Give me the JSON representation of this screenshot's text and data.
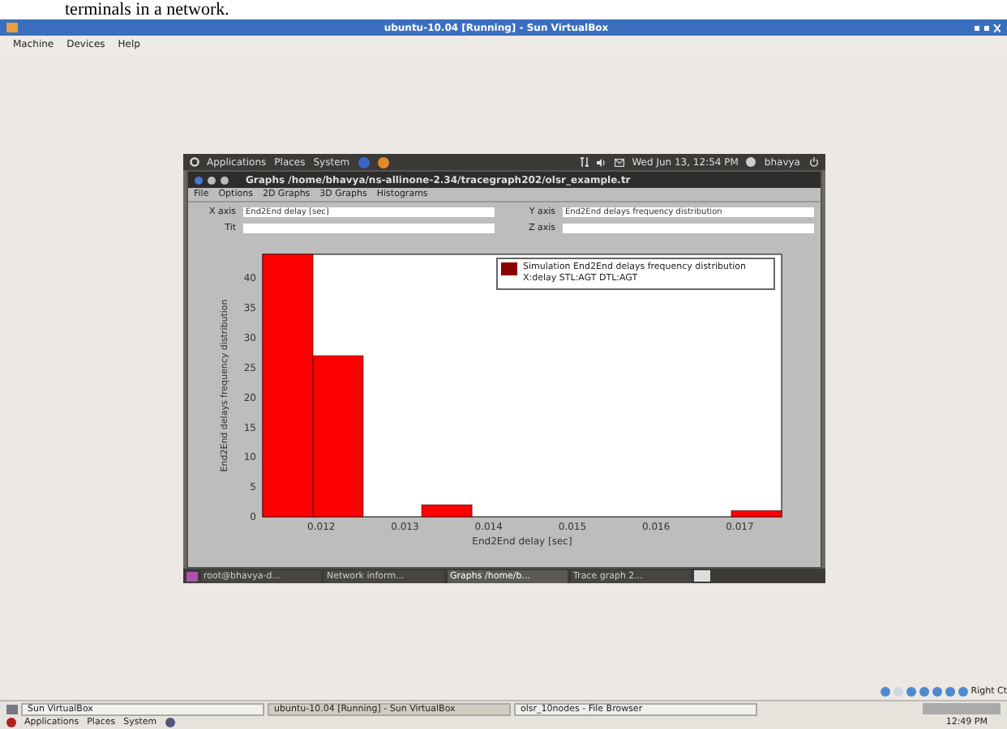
{
  "document_text": "terminals in a network.",
  "window": {
    "title": "ubuntu-10.04 [Running] - Sun VirtualBox",
    "menu": [
      "Machine",
      "Devices",
      "Help"
    ]
  },
  "guest": {
    "panel": {
      "menu": [
        "Applications",
        "Places",
        "System"
      ],
      "clock": "Wed Jun 13, 12:54 PM",
      "user": "bhavya"
    },
    "app": {
      "title": "Graphs  /home/bhavya/ns-allinone-2.34/tracegraph202/olsr_example.tr",
      "menu": [
        "File",
        "Options",
        "2D Graphs",
        "3D Graphs",
        "Histograms"
      ],
      "fields": [
        {
          "label": "X axis",
          "value": "End2End delay [sec]"
        },
        {
          "label": "Y axis",
          "value": "End2End delays frequency distribution"
        },
        {
          "label": "Tit"
        },
        {
          "label": "Z axis"
        }
      ],
      "chart_data": {
        "type": "bar",
        "xlabel": "End2End delay [sec]",
        "ylabel": "End2End delays frequency distribution",
        "x": [
          0.0116,
          0.0122,
          0.0135,
          0.0172
        ],
        "series": [
          {
            "name": "Simulation End2End delays frequency distribution X:delay STL:AGT DTL:AGT",
            "color": "#ff0000",
            "values": [
              44,
              27,
              2,
              1
            ]
          }
        ],
        "xlim": [
          0.0113,
          0.0175
        ],
        "ylim": [
          0,
          44
        ],
        "xticks": [
          0.012,
          0.013,
          0.014,
          0.015,
          0.016,
          0.017
        ],
        "yticks": [
          0,
          5,
          10,
          15,
          20,
          25,
          30,
          35,
          40
        ]
      }
    },
    "taskbar": [
      {
        "label": "root@bhavya-d...",
        "selected": false
      },
      {
        "label": "Network inform...",
        "selected": false
      },
      {
        "label": "Graphs  /home/b...",
        "selected": true
      },
      {
        "label": "Trace graph 2...",
        "selected": false
      }
    ]
  },
  "host_status": {
    "hint": "Right Ct"
  },
  "host_taskbar": [
    {
      "label": "Sun VirtualBox",
      "selected": false
    },
    {
      "label": "ubuntu-10.04 [Running] - Sun VirtualBox",
      "selected": true
    },
    {
      "label": "olsr_10nodes - File Browser",
      "selected": false
    }
  ],
  "host_panel": {
    "menu": [
      "Applications",
      "Places",
      "System"
    ],
    "clock": "12:49 PM"
  }
}
